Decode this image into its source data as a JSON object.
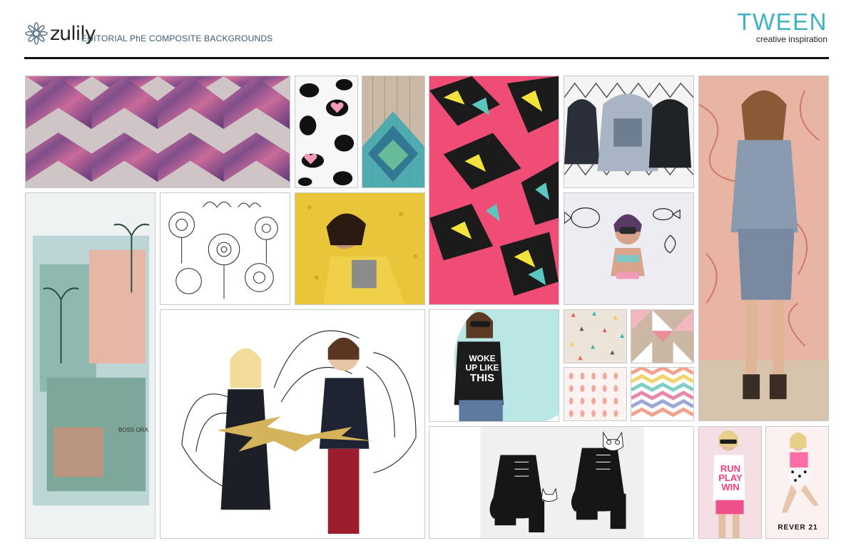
{
  "header": {
    "logo_text": "zulily",
    "subtitle": "EDITORIAL PhE COMPOSITE BACKGROUNDS",
    "brand_title": "TWEEN",
    "brand_subtitle": "creative inspiration"
  },
  "tiles": {
    "pink_tank": {
      "text_line1": "WOKE",
      "text_line2": "UP LIKE",
      "text_line3": "THIS"
    },
    "tee_tile": {
      "text_line1": "RUN",
      "text_line2": "PLAY",
      "text_line3": "WIN"
    },
    "forever_tile": {
      "brand_text": "REVER 21"
    },
    "collage_tile": {
      "caption": "BOSS ORA"
    }
  },
  "colors": {
    "accent": "#3fb2bf",
    "rule": "#111111",
    "subtitle": "#3b5a78"
  }
}
